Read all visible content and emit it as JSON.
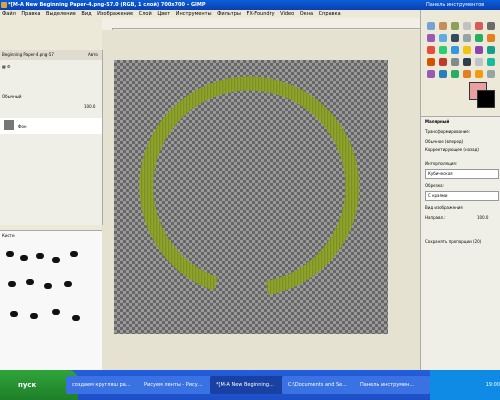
{
  "window": {
    "title": "*[M-A New Beginning Paper-4.png-57.0 (RGB, 1 слой) 700x700 – GIMP"
  },
  "menu": [
    "Файл",
    "Правка",
    "Выделение",
    "Вид",
    "Изображение",
    "Слой",
    "Цвет",
    "Инструменты",
    "Фильтры",
    "FX-Foundry",
    "Video",
    "Окна",
    "Справка"
  ],
  "toolbox": {
    "title": "Панель инструментов",
    "options_title": "Малярный",
    "transform_label": "Трансформирование:",
    "mode_normal": "Обычное (вперед)",
    "mode_corrective": "Корректирующее (назад)",
    "interpolation_label": "Интерполяция:",
    "interpolation_value": "Кубическая",
    "preview_label": "Обрезка:",
    "preview_value": "С краями",
    "view_label": "Вид изображения",
    "hint_label": "Направл.:",
    "hint_value": "100.0",
    "clip_label": "Сохранять пропорции (20)",
    "colors": {
      "fg": "#e8a0a0",
      "bg": "#000000"
    }
  },
  "layers": {
    "image_select": "Beginning Paper-4.png-57",
    "auto_label": "Авто",
    "mode_label": "Обычный",
    "opacity_value": "100.0",
    "layer_name": "Фон"
  },
  "brushes": {
    "label": "Кисти"
  },
  "taskbar": {
    "start_label": "пуск",
    "tasks": [
      {
        "label": "создаем кругляш ра..."
      },
      {
        "label": "Рисуем ленты - Рису..."
      },
      {
        "label": "*[M-A New Beginning..."
      },
      {
        "label": "C:\\Documents and Se..."
      },
      {
        "label": "Панель инструмен..."
      }
    ],
    "clock": "19:00"
  },
  "canvas": {
    "ring_color": "#8ea32c"
  }
}
